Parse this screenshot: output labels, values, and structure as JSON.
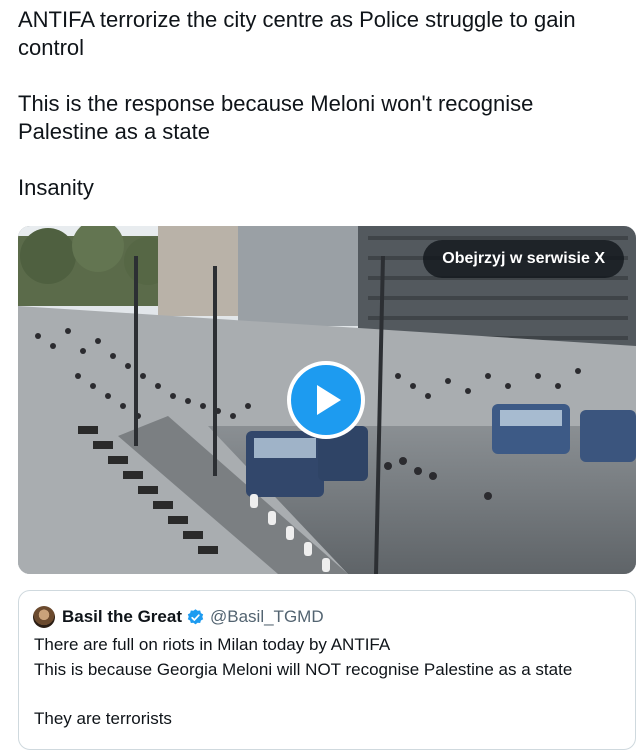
{
  "tweet": {
    "paragraphs": [
      "ANTIFA terrorize the city centre as Police struggle to gain\ncontrol",
      "This is the response because Meloni won't recognise\nPalestine as a state",
      "Insanity"
    ]
  },
  "media": {
    "watch_label": "Obejrzyj w serwisie X",
    "play_icon": "play-icon",
    "description_colors": {
      "accent": "#1d9bf0"
    }
  },
  "quote": {
    "display_name": "Basil the Great",
    "handle": "@Basil_TGMD",
    "verified_icon": "verified-badge-icon",
    "lines": [
      "There are full on riots in Milan today by ANTIFA",
      "This is because Georgia Meloni will NOT recognise Palestine as a state",
      "They are terrorists"
    ]
  }
}
